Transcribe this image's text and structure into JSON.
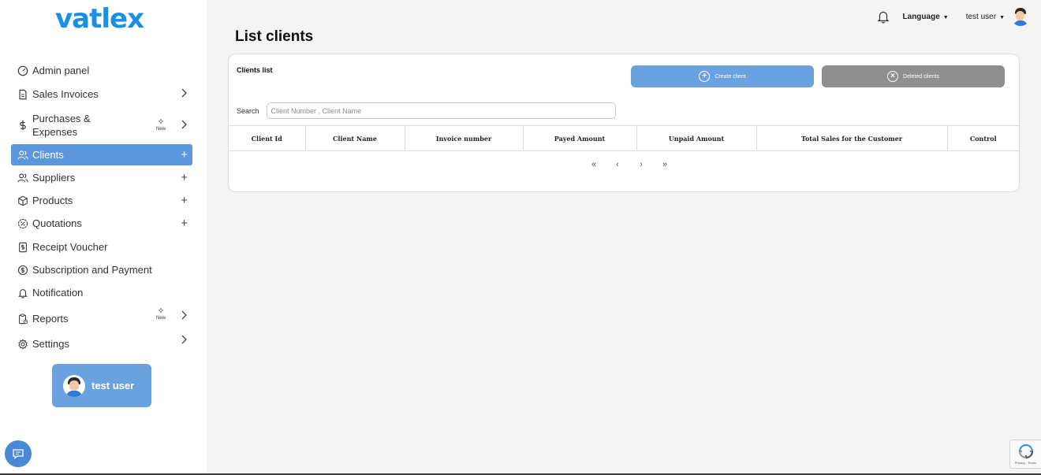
{
  "brand": {
    "logo": "vatlex"
  },
  "sidebar": {
    "items": [
      {
        "label": "Admin panel",
        "icon": "gauge-icon",
        "tail": ""
      },
      {
        "label": "Sales Invoices",
        "icon": "invoice-icon",
        "tail": "chevron"
      },
      {
        "label": "Purchases & Expenses",
        "icon": "dollar-icon",
        "tail": "chevron",
        "badge": "New"
      },
      {
        "label": "Clients",
        "icon": "users-icon",
        "tail": "+"
      },
      {
        "label": "Suppliers",
        "icon": "users-icon",
        "tail": "+"
      },
      {
        "label": "Products",
        "icon": "box-icon",
        "tail": "+"
      },
      {
        "label": "Quotations",
        "icon": "percent-badge-icon",
        "tail": "+"
      },
      {
        "label": "Receipt Voucher",
        "icon": "receipt-icon",
        "tail": ""
      },
      {
        "label": "Subscription and Payment",
        "icon": "coin-icon",
        "tail": ""
      },
      {
        "label": "Notification",
        "icon": "bell-icon",
        "tail": ""
      },
      {
        "label": "Reports",
        "icon": "clipboard-icon",
        "tail": "chevron",
        "badge": "New"
      },
      {
        "label": "Settings",
        "icon": "gear-icon",
        "tail": "chevron"
      }
    ],
    "active_index": 3,
    "user_card": {
      "name": "test user"
    }
  },
  "topbar": {
    "language": "Language",
    "user": "test user"
  },
  "page": {
    "title": "List clients"
  },
  "card": {
    "title": "Clients list",
    "create_button": "Create client",
    "deleted_button": "Deleted clients",
    "search_label": "Search",
    "search_placeholder": "Client Number , Client Name",
    "columns": [
      "Client Id",
      "Client Name",
      "Invoice number",
      "Payed Amount",
      "Unpaid Amount",
      "Total Sales for the Customer",
      "Control"
    ],
    "pager": [
      "«",
      "‹",
      "›",
      "»"
    ]
  },
  "recaptcha": {
    "text": "Privacy - Terms"
  },
  "colors": {
    "accent": "#6aa2e0",
    "active": "#5c96dc",
    "brand": "#1a8fe3",
    "muted_button": "#8f8f8f"
  }
}
